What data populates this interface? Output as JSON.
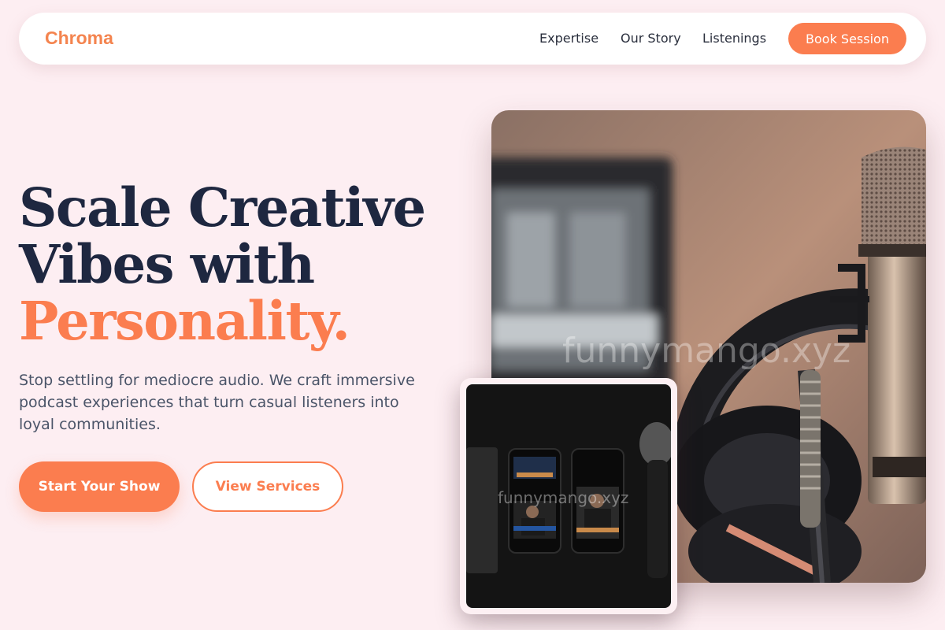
{
  "header": {
    "brand": "Chroma",
    "nav": [
      "Expertise",
      "Our Story",
      "Listenings"
    ],
    "cta": "Book Session"
  },
  "hero": {
    "headline_line1": "Scale Creative",
    "headline_line2": "Vibes with",
    "headline_accent": "Personality.",
    "subtext": "Stop settling for mediocre audio. We craft immersive podcast experiences that turn casual listeners into loyal communities.",
    "primary_cta": "Start Your Show",
    "secondary_cta": "View Services"
  },
  "images": {
    "main_watermark": "funnymango.xyz",
    "inset_watermark": "funnymango.xyz"
  },
  "colors": {
    "background": "#fdeef2",
    "accent": "#fb7d4f",
    "heading": "#1e2740",
    "body_text": "#4a5468"
  }
}
